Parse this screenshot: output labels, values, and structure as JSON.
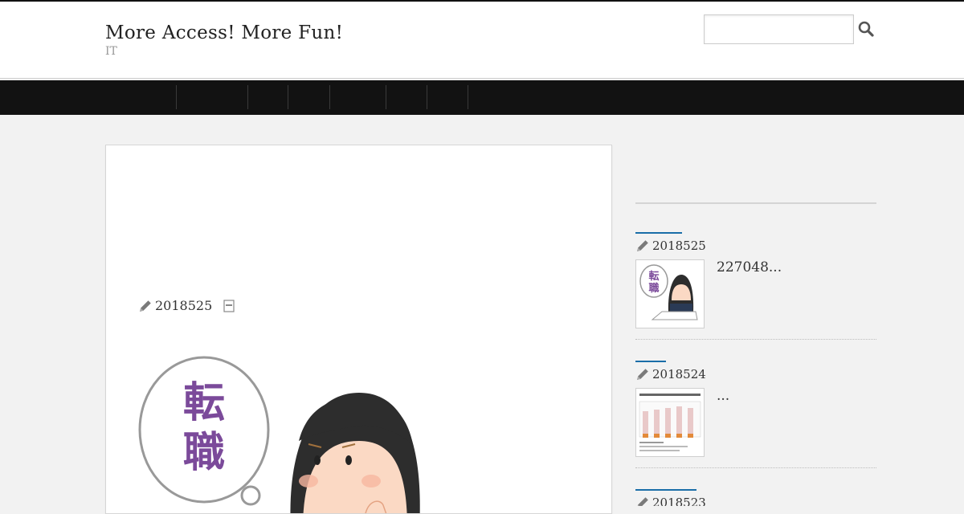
{
  "header": {
    "site_title": "More Access! More Fun!",
    "site_description": "IT",
    "search": {
      "value": "",
      "placeholder": ""
    }
  },
  "nav": {
    "items": [
      "",
      "",
      "",
      "",
      "",
      "",
      ""
    ]
  },
  "main": {
    "post_date": "2018525",
    "illustration_text": [
      "転",
      "職"
    ]
  },
  "sidebar": {
    "posts": [
      {
        "date": "2018525",
        "excerpt": "227048..."
      },
      {
        "date": "2018524",
        "excerpt": "..."
      },
      {
        "date": "2018523",
        "excerpt": ""
      }
    ]
  },
  "colors": {
    "nav_bg": "#121212",
    "accent": "#1a6ea8",
    "illustration_purple": "#7b4a9a"
  }
}
